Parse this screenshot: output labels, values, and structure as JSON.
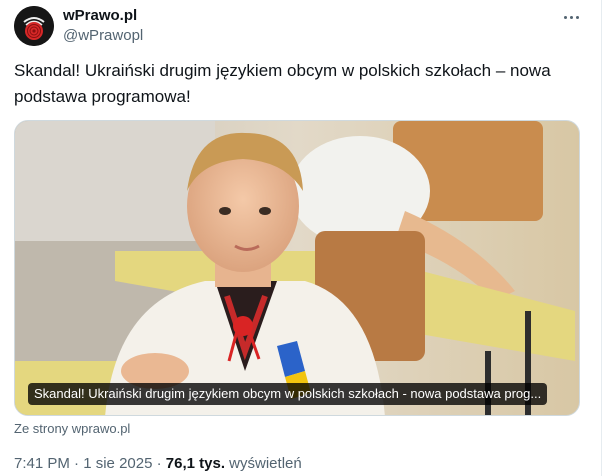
{
  "author": {
    "display_name": "wPrawo.pl",
    "handle": "@wPrawopl",
    "avatar_icon": "fingerprint-logo-icon"
  },
  "tweet": {
    "text": "Skandal! Ukraiński drugim językiem obcym w polskich szkołach – nowa podstawa programowa!"
  },
  "media": {
    "caption": "Skandal! Ukraiński drugim językiem obcym w polskich szkołach - nowa podstawa prog..."
  },
  "link_source": "Ze strony wprawo.pl",
  "meta": {
    "time": "7:41 PM",
    "sep1": " · ",
    "date": "1 sie 2025",
    "sep2": " · ",
    "views_count": "76,1 tys.",
    "views_label": " wyświetleń"
  },
  "colors": {
    "text_primary": "#0f1419",
    "text_secondary": "#536471",
    "border": "#cfd9de",
    "avatar_accent": "#d62828"
  }
}
